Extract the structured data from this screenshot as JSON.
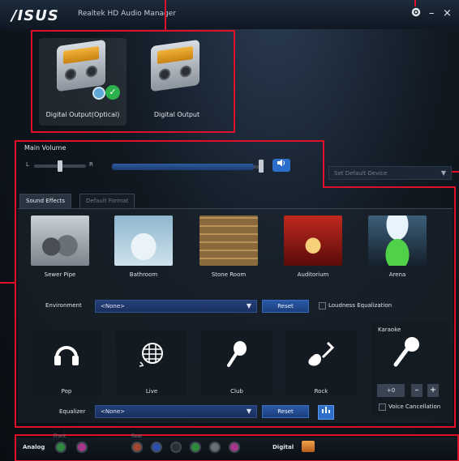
{
  "titlebar": {
    "logo": "/ISUS",
    "title": "Realtek HD Audio Manager",
    "settings_icon": "gear-icon",
    "minimize_label": "–",
    "close_label": "×"
  },
  "devices": [
    {
      "label": "Digital Output(Optical)",
      "selected": true,
      "status": "default"
    },
    {
      "label": "Digital Output",
      "selected": false
    }
  ],
  "volume": {
    "label": "Main Volume",
    "left": "L",
    "right": "R",
    "level": 0.94,
    "balance": 0.0,
    "mute_icon": "speaker-icon"
  },
  "default_device": {
    "label": "Set Default Device"
  },
  "tabs": [
    {
      "label": "Sound Effects",
      "active": true
    },
    {
      "label": "Default Format",
      "active": false
    }
  ],
  "environments": [
    {
      "label": "Sewer Pipe"
    },
    {
      "label": "Bathroom"
    },
    {
      "label": "Stone Room"
    },
    {
      "label": "Auditorium"
    },
    {
      "label": "Arena"
    }
  ],
  "environment_row": {
    "label": "Environment",
    "value": "<None>",
    "reset": "Reset",
    "loudness": "Loudness Equalization"
  },
  "equalizer_presets": [
    {
      "label": "Pop",
      "icon": "headphones-icon"
    },
    {
      "label": "Live",
      "icon": "disco-ball-icon"
    },
    {
      "label": "Club",
      "icon": "microphone-icon"
    },
    {
      "label": "Rock",
      "icon": "guitar-icon"
    }
  ],
  "karaoke": {
    "label": "Karaoke",
    "value": "+0",
    "minus": "–",
    "plus": "+",
    "voice_cancellation": "Voice Cancellation"
  },
  "equalizer_row": {
    "label": "Equalizer",
    "value": "<None>",
    "reset": "Reset"
  },
  "jacks": {
    "analog_label": "Analog",
    "front_label": "Front",
    "rear_label": "Rear",
    "digital_label": "Digital",
    "front_colors": [
      "#2f8a3b",
      "#a8368a"
    ],
    "rear_colors": [
      "#a0452e",
      "#2d4fae",
      "#2b2f34",
      "#2f8a3b",
      "#6c6f73",
      "#a8368a"
    ]
  },
  "colors": {
    "annotation": "#e0102a",
    "accent": "#2c6ec9"
  }
}
